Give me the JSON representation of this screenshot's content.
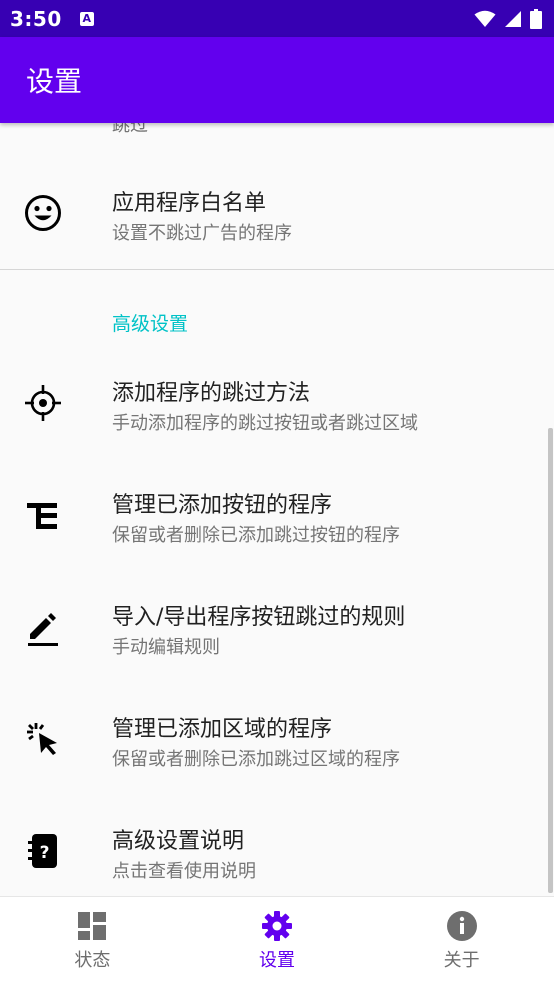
{
  "status_bar": {
    "time": "3:50",
    "notif_glyph": "A",
    "icons": [
      "wifi-icon",
      "signal-icon",
      "battery-icon"
    ]
  },
  "app_bar": {
    "title": "设置"
  },
  "clipped_item": {
    "summary": "跳过"
  },
  "items": [
    {
      "icon": "smiley-icon",
      "title": "应用程序白名单",
      "summary": "设置不跳过广告的程序"
    },
    {
      "icon": "crosshair-icon",
      "title": "添加程序的跳过方法",
      "summary": "手动添加程序的跳过按钮或者跳过区域"
    },
    {
      "icon": "list-tree-icon",
      "title": "管理已添加按钮的程序",
      "summary": "保留或者删除已添加跳过按钮的程序"
    },
    {
      "icon": "pencil-icon",
      "title": "导入/导出程序按钮跳过的规则",
      "summary": "手动编辑规则"
    },
    {
      "icon": "pointer-click-icon",
      "title": "管理已添加区域的程序",
      "summary": "保留或者删除已添加跳过区域的程序"
    },
    {
      "icon": "help-book-icon",
      "title": "高级设置说明",
      "summary": "点击查看使用说明"
    }
  ],
  "category": {
    "label": "高级设置"
  },
  "bottom_nav": {
    "items": [
      {
        "icon": "dashboard-icon",
        "label": "状态",
        "active": false
      },
      {
        "icon": "gear-icon",
        "label": "设置",
        "active": true
      },
      {
        "icon": "info-icon",
        "label": "关于",
        "active": false
      }
    ]
  },
  "colors": {
    "status_bar": "#3700b3",
    "app_bar": "#6200ee",
    "accent_category": "#00c2c7",
    "active_nav": "#6200ee"
  }
}
